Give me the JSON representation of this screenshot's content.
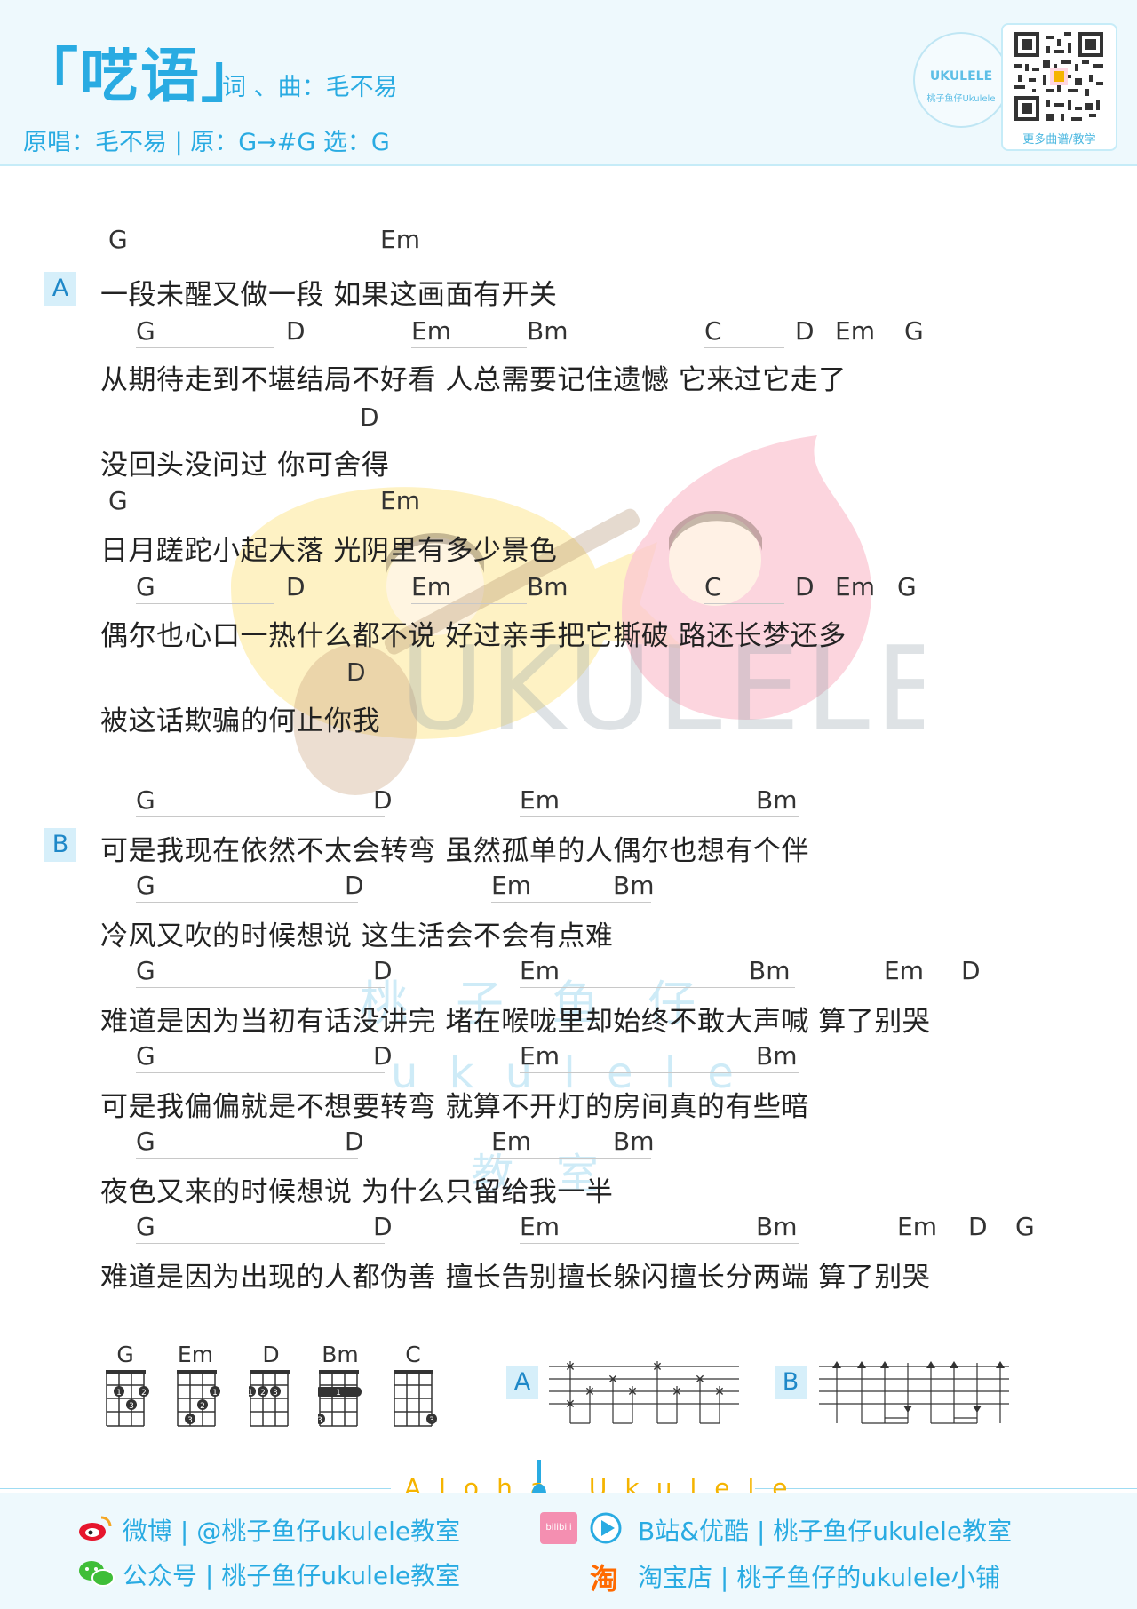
{
  "header": {
    "title": "「呓语」",
    "credits": "词 、曲：毛不易",
    "meta": "原唱：毛不易 | 原：G→#G 选：G",
    "logo_text": "UKULELE",
    "logo_subtext": "桃子鱼仔Ukulele",
    "qr_caption": "更多曲谱/教学"
  },
  "watermark": {
    "big_text": "UKULELE",
    "line1": "桃　子　鱼　仔",
    "line2": "u k u l e l e",
    "line3": "教　室"
  },
  "sections": [
    {
      "label": "A"
    },
    {
      "label": "B"
    }
  ],
  "lines": [
    {
      "lyric": "一段未醒又做一段  如果这画面有开关",
      "chords": [
        "G",
        "Em"
      ]
    },
    {
      "lyric": "从期待走到不堪结局不好看  人总需要记住遗憾  它来过它走了",
      "chords": [
        "G",
        "D",
        "Em",
        "Bm",
        "C",
        "D",
        "Em",
        "G"
      ]
    },
    {
      "lyric": "没回头没问过  你可舍得",
      "chords": [
        "D"
      ]
    },
    {
      "lyric": "日月蹉跎小起大落  光阴里有多少景色",
      "chords": [
        "G",
        "Em"
      ]
    },
    {
      "lyric": "偶尔也心口一热什么都不说  好过亲手把它撕破  路还长梦还多",
      "chords": [
        "G",
        "D",
        "Em",
        "Bm",
        "C",
        "D",
        "Em",
        "G"
      ]
    },
    {
      "lyric": "被这话欺骗的何止你我",
      "chords": [
        "D"
      ]
    },
    {
      "lyric": "可是我现在依然不太会转弯  虽然孤单的人偶尔也想有个伴",
      "chords": [
        "G",
        "D",
        "Em",
        "Bm"
      ]
    },
    {
      "lyric": "冷风又吹的时候想说  这生活会不会有点难",
      "chords": [
        "G",
        "D",
        "Em",
        "Bm"
      ]
    },
    {
      "lyric": "难道是因为当初有话没讲完  堵在喉咙里却始终不敢大声喊  算了别哭",
      "chords": [
        "G",
        "D",
        "Em",
        "Bm",
        "Em",
        "D"
      ]
    },
    {
      "lyric": "可是我偏偏就是不想要转弯  就算不开灯的房间真的有些暗",
      "chords": [
        "G",
        "D",
        "Em",
        "Bm"
      ]
    },
    {
      "lyric": "夜色又来的时候想说  为什么只留给我一半",
      "chords": [
        "G",
        "D",
        "Em",
        "Bm"
      ]
    },
    {
      "lyric": "难道是因为出现的人都伪善  擅长告别擅长躲闪擅长分两端  算了别哭",
      "chords": [
        "G",
        "D",
        "Em",
        "Bm",
        "Em",
        "D",
        "G"
      ]
    }
  ],
  "chord_diagrams": [
    {
      "name": "G",
      "fingers": [
        "1",
        "2",
        "3"
      ]
    },
    {
      "name": "Em",
      "fingers": [
        "1",
        "2",
        "3"
      ]
    },
    {
      "name": "D",
      "fingers": [
        "1",
        "2",
        "3"
      ]
    },
    {
      "name": "Bm",
      "fingers": [
        "1",
        "3"
      ]
    },
    {
      "name": "C",
      "fingers": [
        "3"
      ]
    }
  ],
  "strum_patterns": [
    {
      "label": "A"
    },
    {
      "label": "B"
    }
  ],
  "footer": {
    "aloha": "Aloha Ukulele",
    "weibo": "微博 | @桃子鱼仔ukulele教室",
    "wechat": "公众号  |  桃子鱼仔ukulele教室",
    "bilibili": "B站&优酷  |  桃子鱼仔ukulele教室",
    "taobao": "淘宝店  |  桃子鱼仔的ukulele小铺",
    "bili_badge": "bilibili",
    "taobao_icon": "淘"
  },
  "colors": {
    "accent": "#29abe2",
    "header_bg": "#eef9fd",
    "label_bg": "#d6effa",
    "aloha": "#f5b400"
  }
}
